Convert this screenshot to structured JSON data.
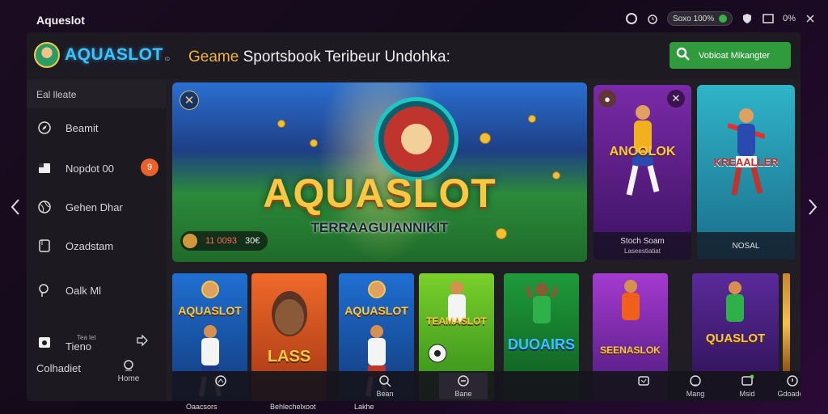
{
  "os": {
    "title": "Aqueslot",
    "pill_text": "Soxo 100%",
    "percent": "0%"
  },
  "header": {
    "logo_text": "AQUASLOT",
    "logo_sub": "ID",
    "headline_highlight": "Geame",
    "headline_rest": " Sportsbook Teribeur Undohka:",
    "cta_label": "Vobioat Mikangter"
  },
  "sidebar": {
    "heading": "Eal lleate",
    "items": [
      {
        "label": "Beamit",
        "icon": "compass-icon"
      },
      {
        "label": "Nopdot 00",
        "icon": "wallet-icon",
        "badge": "9"
      },
      {
        "label": "Gehen Dhar",
        "icon": "globe-icon"
      },
      {
        "label": "Ozadstam",
        "icon": "document-icon"
      },
      {
        "label": "Oalk Ml",
        "icon": "chat-icon"
      },
      {
        "label": "Tieno",
        "icon": "camera-icon",
        "sub": "Tea let"
      }
    ],
    "footer_label": "Colhadiet",
    "home_label": "Home"
  },
  "hero": {
    "brand": "AQUASLOT",
    "tagline": "TERRAAGUIANNIKIT",
    "score_red": "11 0093",
    "score_value": "30€"
  },
  "side_cards": [
    {
      "title": "ANOOLOK",
      "foot1": "Stoch Soam",
      "foot2": "Laseestiatiat"
    },
    {
      "title": "KREAALLER",
      "foot1": "NOSAL",
      "foot2": ""
    }
  ],
  "tiles": [
    {
      "name": "AQUASLOT"
    },
    {
      "name": "LASS"
    },
    {
      "name": "AQUASLOT"
    },
    {
      "name": "TEAMASLOT"
    },
    {
      "name": "DUOAIRS"
    },
    {
      "name": "SEENASLOK"
    },
    {
      "name": "QUASLOT"
    }
  ],
  "bottom_nav": [
    {
      "label": "",
      "icon": "user-icon"
    },
    {
      "label": "Bean",
      "icon": "search-icon"
    },
    {
      "label": "Bane",
      "icon": "controller-icon"
    },
    {
      "label": "",
      "icon": "trophy-icon"
    },
    {
      "label": "Mang",
      "icon": "gift-icon"
    },
    {
      "label": "Msid",
      "icon": "message-icon"
    },
    {
      "label": "Gdoadon",
      "icon": "settings-icon"
    }
  ],
  "captions": {
    "c1": "Oaacsors",
    "c2": "Behlechelxoot",
    "c3": "Lakhe"
  },
  "colors": {
    "accent": "#2f9b3d",
    "brand_gold": "#f7c843",
    "badge": "#e8622c"
  }
}
